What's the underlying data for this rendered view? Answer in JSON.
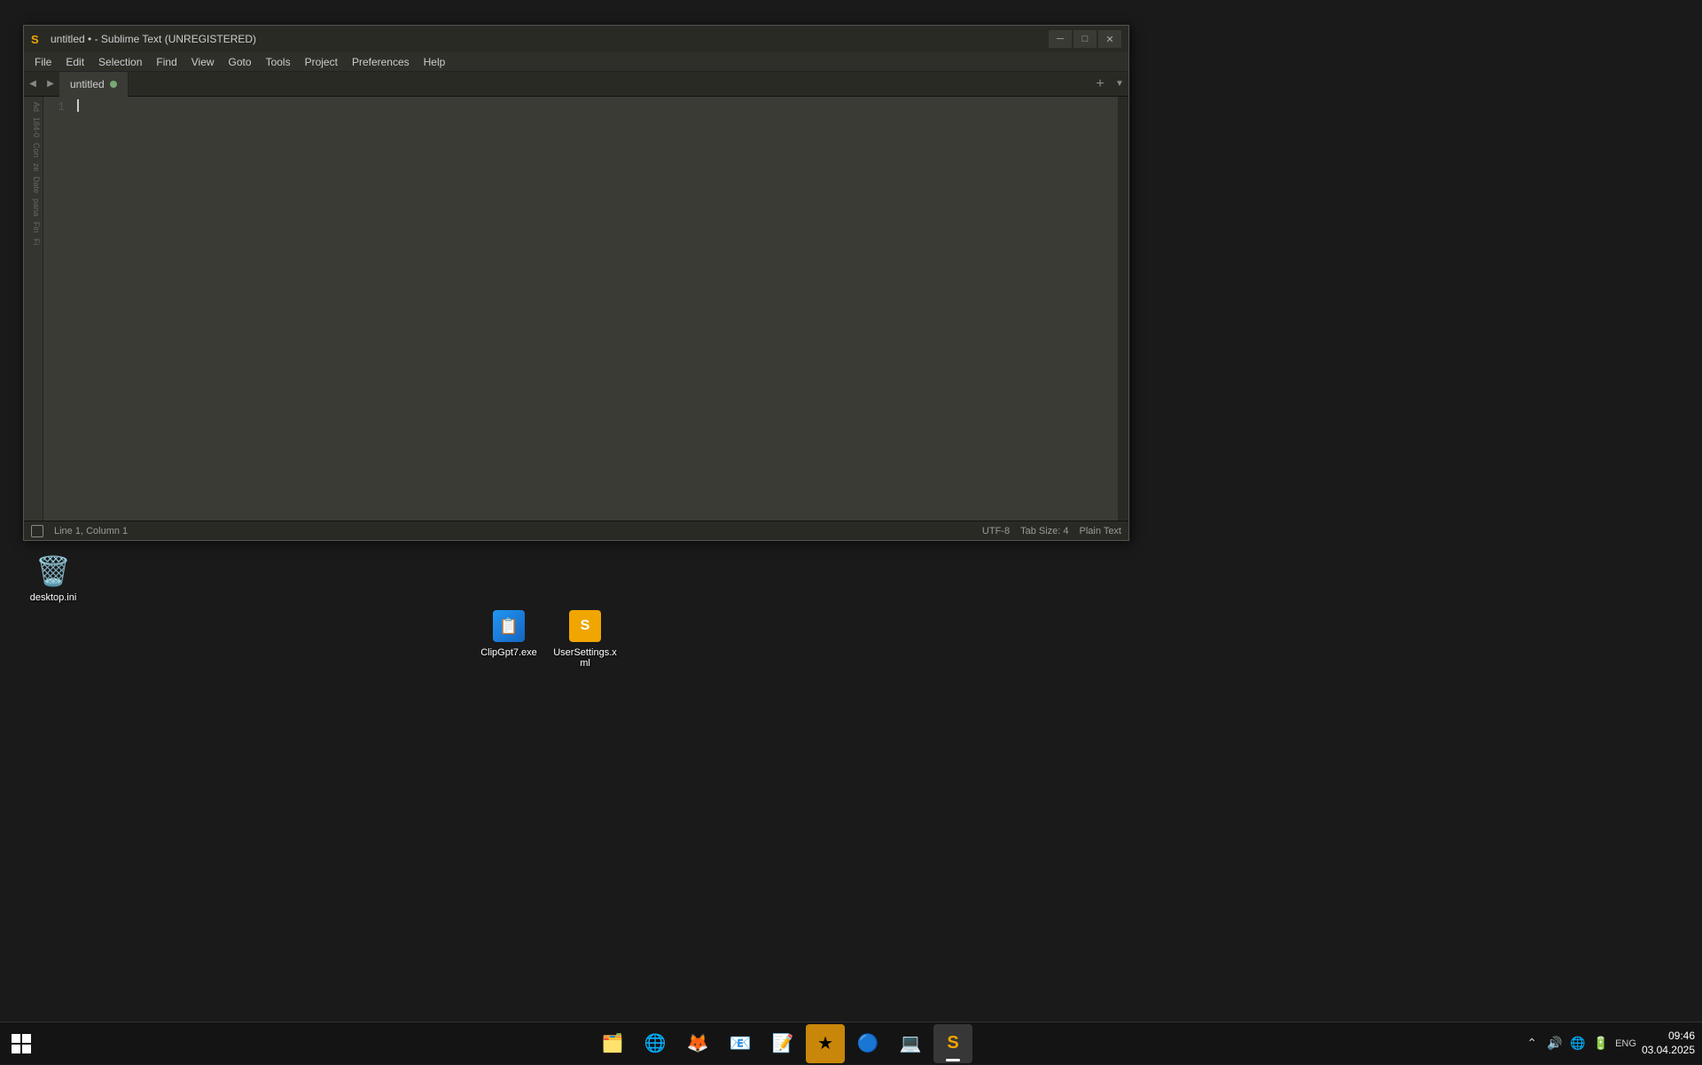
{
  "window": {
    "title": "untitled • - Sublime Text (UNREGISTERED)",
    "icon": "S",
    "tab_name": "untitled",
    "tab_modified": true
  },
  "menu": {
    "items": [
      "File",
      "Edit",
      "Selection",
      "Find",
      "View",
      "Goto",
      "Tools",
      "Project",
      "Preferences",
      "Help"
    ]
  },
  "editor": {
    "line_number": "1",
    "status_position": "Line 1, Column 1",
    "encoding": "UTF-8",
    "tab_size": "Tab Size: 4",
    "syntax": "Plain Text"
  },
  "sidebar": {
    "items": [
      "Ad",
      "184-0",
      "Con",
      "ze",
      "Date",
      "pana",
      "Fin",
      "Fi"
    ]
  },
  "desktop_icons": [
    {
      "label": "desktop.ini",
      "type": "recycle"
    },
    {
      "label": "ClipGpt7.exe",
      "type": "clipgpt"
    },
    {
      "label": "UserSettings.xml",
      "type": "xml"
    }
  ],
  "taskbar": {
    "tray": {
      "language": "ENG",
      "time": "09:46",
      "date": "03.04.2025"
    },
    "apps": [
      {
        "name": "windows-start",
        "label": "Start"
      },
      {
        "name": "file-explorer",
        "label": "File Explorer"
      },
      {
        "name": "browser",
        "label": "Browser"
      },
      {
        "name": "firefox",
        "label": "Firefox"
      },
      {
        "name": "outlook",
        "label": "Outlook"
      },
      {
        "name": "word",
        "label": "Word"
      },
      {
        "name": "app6",
        "label": "App"
      },
      {
        "name": "app7",
        "label": "App"
      },
      {
        "name": "powershell",
        "label": "PowerShell"
      },
      {
        "name": "sublime",
        "label": "Sublime Text",
        "active": true
      }
    ]
  },
  "title_buttons": {
    "minimize": "─",
    "maximize": "□",
    "close": "✕"
  }
}
